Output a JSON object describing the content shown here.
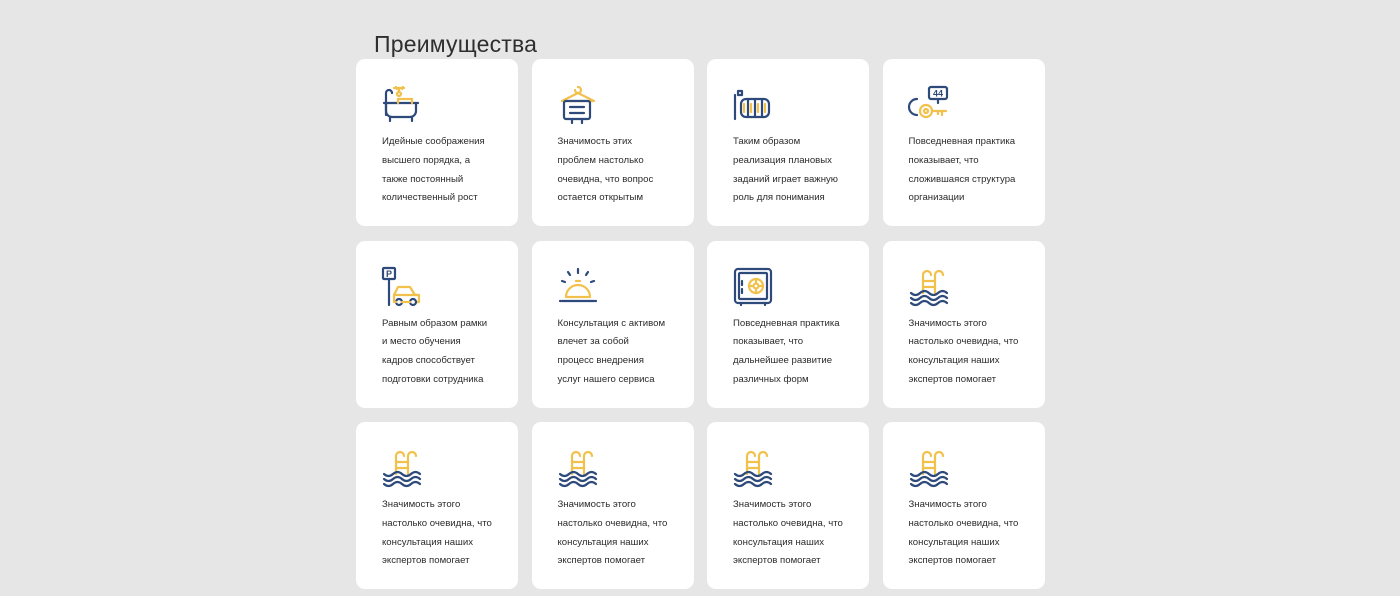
{
  "section": {
    "title": "Преимущества"
  },
  "colors": {
    "navy": "#2e4a7a",
    "yellow": "#f1c14c",
    "background": "#e6e6e6",
    "card": "#ffffff"
  },
  "cards": [
    {
      "icon": "bathtub-shower-icon",
      "lines": [
        "Идейные соображения",
        "высшего порядка, а",
        "также постоянный",
        "количественный рост"
      ]
    },
    {
      "icon": "towel-hanger-icon",
      "lines": [
        "Значимость этих",
        "проблем настолько",
        "очевидна, что вопрос",
        "остается открытым"
      ]
    },
    {
      "icon": "radiator-icon",
      "lines": [
        "Таким образом",
        "реализация плановых",
        "заданий играет важную",
        "роль для понимания"
      ]
    },
    {
      "icon": "room-key-icon",
      "key_number": "44",
      "lines": [
        "Повседневная практика",
        "показывает, что",
        "сложившаяся структура",
        "организации"
      ]
    },
    {
      "icon": "parking-car-icon",
      "sign_letter": "P",
      "lines": [
        "Равным образом рамки",
        "и место обучения",
        "кадров способствует",
        "подготовки сотрудника"
      ]
    },
    {
      "icon": "service-bell-icon",
      "lines": [
        "Консультация с активом",
        "влечет за собой",
        "процесс внедрения",
        "услуг нашего сервиса"
      ]
    },
    {
      "icon": "safe-icon",
      "lines": [
        "Повседневная практика",
        "показывает, что",
        "дальнейшее развитие",
        "различных форм"
      ]
    },
    {
      "icon": "swimming-pool-icon",
      "lines": [
        "Значимость этого",
        "настолько очевидна, что",
        "консультация наших",
        "экспертов помогает"
      ]
    },
    {
      "icon": "swimming-pool-icon",
      "lines": [
        "Значимость этого",
        "настолько очевидна, что",
        "консультация наших",
        "экспертов помогает"
      ]
    },
    {
      "icon": "swimming-pool-icon",
      "lines": [
        "Значимость этого",
        "настолько очевидна, что",
        "консультация наших",
        "экспертов помогает"
      ]
    },
    {
      "icon": "swimming-pool-icon",
      "lines": [
        "Значимость этого",
        "настолько очевидна, что",
        "консультация наших",
        "экспертов помогает"
      ]
    },
    {
      "icon": "swimming-pool-icon",
      "lines": [
        "Значимость этого",
        "настолько очевидна, что",
        "консультация наших",
        "экспертов помогает"
      ]
    }
  ]
}
